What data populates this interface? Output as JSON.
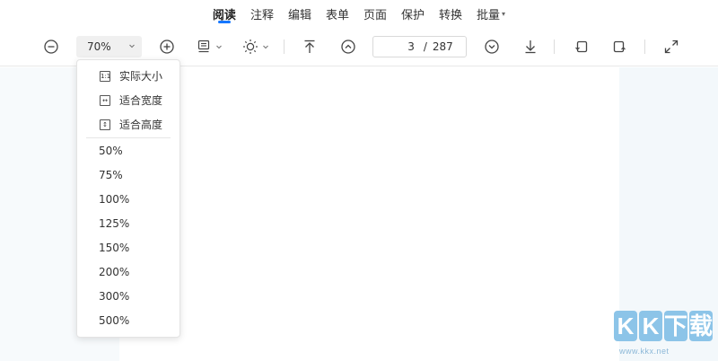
{
  "tabs": [
    {
      "label": "阅读",
      "active": true
    },
    {
      "label": "注释"
    },
    {
      "label": "编辑"
    },
    {
      "label": "表单"
    },
    {
      "label": "页面"
    },
    {
      "label": "保护"
    },
    {
      "label": "转换"
    },
    {
      "label": "批量",
      "has_dropdown": true
    }
  ],
  "toolbar": {
    "zoom_value": "70%",
    "page_current": "3",
    "page_separator": "/",
    "page_total": "287"
  },
  "zoom_menu": {
    "fit_items": [
      {
        "icon": "actual-size-icon",
        "icon_text": "1:1",
        "label": "实际大小"
      },
      {
        "icon": "fit-width-icon",
        "icon_text": "↔",
        "label": "适合宽度"
      },
      {
        "icon": "fit-height-icon",
        "icon_text": "↕",
        "label": "适合高度"
      }
    ],
    "percent_items": [
      "50%",
      "75%",
      "100%",
      "125%",
      "150%",
      "200%",
      "300%",
      "500%"
    ]
  },
  "watermark": {
    "logo": [
      "K",
      "K",
      "下",
      "载"
    ],
    "url": "www.kkx.net"
  },
  "colors": {
    "accent": "#1677ff",
    "canvas_bg": "#f3f8fb",
    "watermark": "#8cc4e8"
  }
}
